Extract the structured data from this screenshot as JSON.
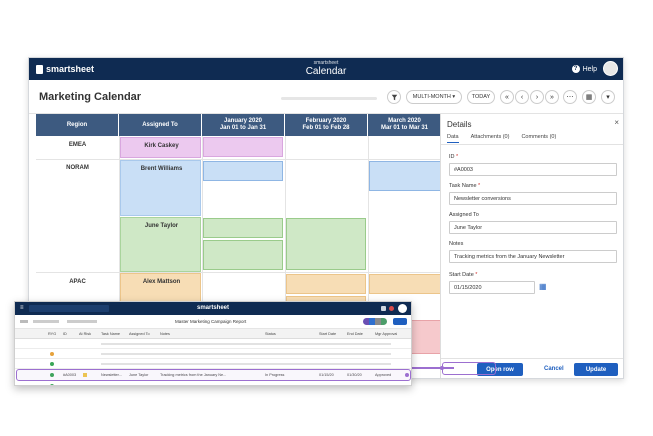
{
  "app": {
    "brand": "smartsheet",
    "top_sub": "smartsheet",
    "top_title": "Calendar",
    "help_label": "Help",
    "colors": {
      "navy": "#0f2b52",
      "header_blue": "#3d5a80",
      "accent": "#1f5fbf",
      "highlight": "#9c6fd0"
    }
  },
  "toolbar": {
    "title": "Marketing Calendar",
    "filter_icon": "filter-icon",
    "view_label": "MULTI-MONTH ▾",
    "today_label": "TODAY",
    "prev_prev": "«",
    "prev": "‹",
    "next": "›",
    "next_next": "»",
    "more": "⋯",
    "calendar_icon": "▦",
    "dropdown": "▾"
  },
  "grid": {
    "headers": [
      {
        "line1": "Region",
        "line2": ""
      },
      {
        "line1": "Assigned To",
        "line2": ""
      },
      {
        "line1": "January 2020",
        "line2": "Jan 01 to Jan 31"
      },
      {
        "line1": "February 2020",
        "line2": "Feb 01 to Feb 28"
      },
      {
        "line1": "March 2020",
        "line2": "Mar 01 to Mar 31"
      }
    ],
    "regions": [
      "EMEA",
      "NORAM",
      "APAC"
    ],
    "assignees": [
      "Kirk Caskey",
      "Brent Williams",
      "June Taylor",
      "Alex Mattson"
    ]
  },
  "details": {
    "title": "Details",
    "close": "×",
    "tabs": [
      "Data",
      "Attachments (0)",
      "Comments (0)"
    ],
    "fields": [
      {
        "label": "ID",
        "value": "#A0003",
        "required": "*"
      },
      {
        "label": "Task Name",
        "value": "Newsletter conversions",
        "required": "*"
      },
      {
        "label": "Assigned To",
        "value": "June Taylor",
        "required": ""
      },
      {
        "label": "Notes",
        "value": "Tracking metrics from the January Newsletter",
        "required": ""
      },
      {
        "label": "Start Date",
        "value": "01/15/2020",
        "required": "*"
      }
    ],
    "calendar_icon": "▦",
    "open_row": "Open row",
    "cancel": "Cancel",
    "update": "Update"
  },
  "sheet": {
    "menu_icon": "≡",
    "brand": "smartsheet",
    "title": "Master Marketing Campaign Report",
    "columns": [
      "",
      "",
      "RYG",
      "ID",
      "At Risk",
      "Task Name",
      "Assigned To",
      "Notes",
      "Status",
      "Start Date",
      "End Date",
      "Mgr Approval"
    ],
    "highlight_row": {
      "id": "#A0003",
      "task": "Newsletter...",
      "assigned": "June Taylor",
      "notes": "Tracking metrics from the January Ne...",
      "status": "In Progress",
      "start": "01/15/20",
      "end": "01/30/20",
      "approval": "Approved"
    }
  }
}
